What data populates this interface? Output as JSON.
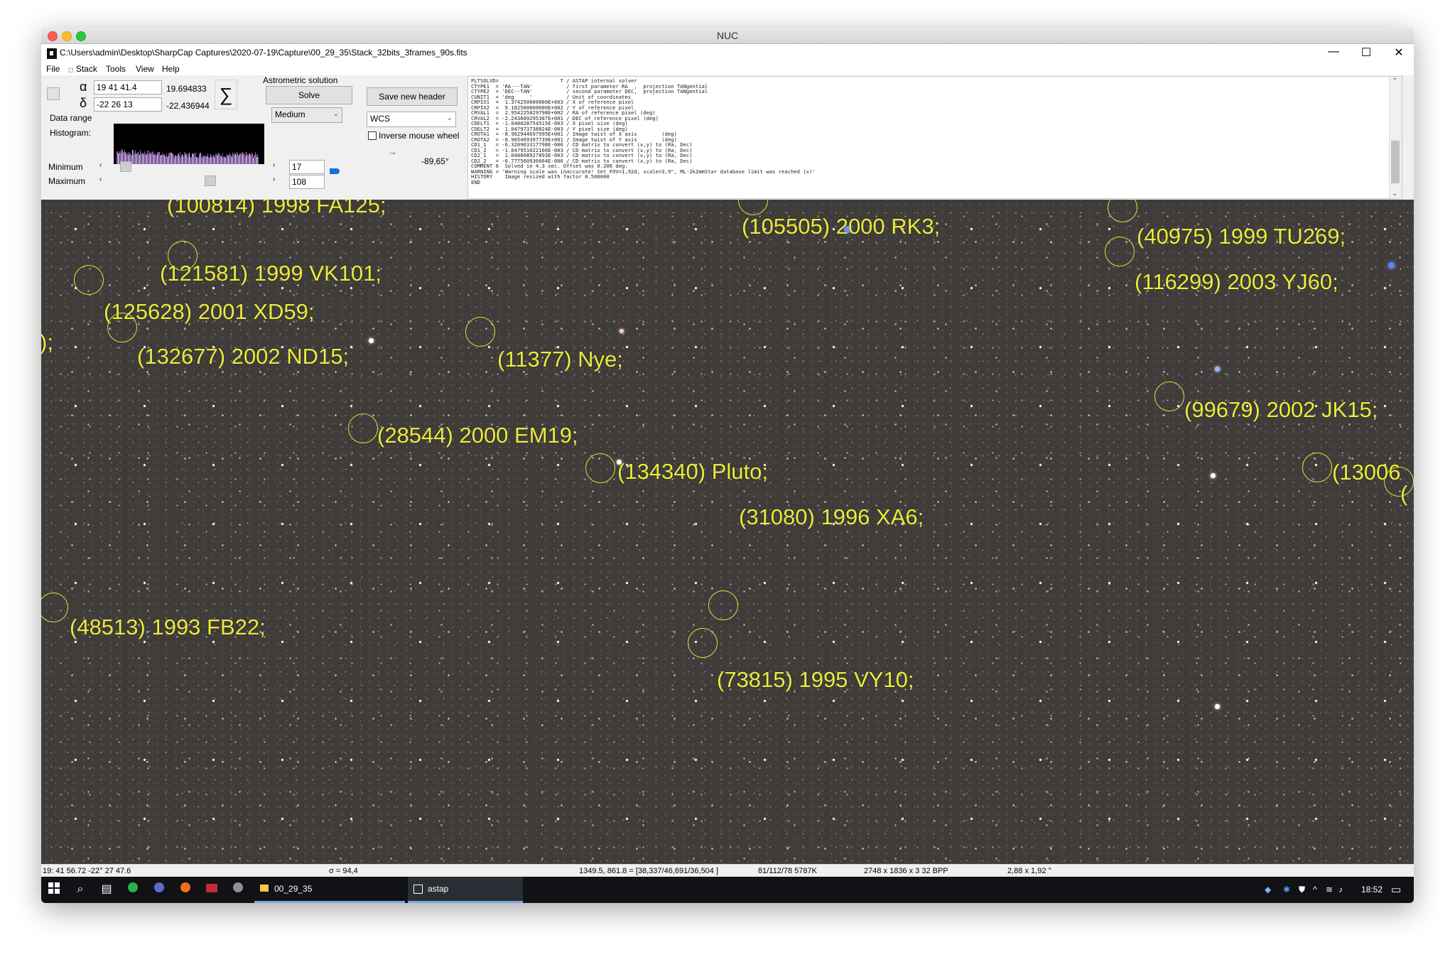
{
  "mac_window": {
    "title": "NUC"
  },
  "app": {
    "path_title": "C:\\Users\\admin\\Desktop\\SharpCap Captures\\2020-07-19\\Capture\\00_29_35\\Stack_32bits_3frames_90s.fits",
    "window_controls": {
      "minimize": "—",
      "maximize": "☐",
      "close": "✕"
    }
  },
  "menu": {
    "file": "File",
    "stack": "Stack",
    "tools": "Tools",
    "view": "View",
    "help": "Help"
  },
  "panel": {
    "alpha_symbol": "α",
    "delta_symbol": "δ",
    "ra_input": "19 41  41.4",
    "ra_decimal": "19.694833",
    "dec_input": "-22 26  13",
    "dec_decimal": "-22.436944",
    "sigma_symbol": "∑",
    "data_range_label": "Data range",
    "histogram_label": "Histogram:",
    "minimum_label": "Minimum",
    "maximum_label": "Maximum",
    "minimum_value": "17",
    "maximum_value": "108",
    "minimum_slider_fraction": 0.07,
    "maximum_slider_fraction": 0.5,
    "range_select": "2",
    "quality_select": "Medium",
    "astrometric_label": "Astrometric solution",
    "solve_button": "Solve",
    "save_header_button": "Save new header",
    "projection_select": "WCS",
    "inverse_wheel_label": "Inverse mouse wheel",
    "inverse_wheel_checked": false,
    "rotation_readout": "-89,65°"
  },
  "fits_header": [
    "PLTSOLVD=                    T / ASTAP internal solver",
    "CTYPE1  = 'RA---TAN'           / first parameter RA  ,  projection TANgential",
    "CTYPE2  = 'DEC--TAN'           / second parameter DEC,  projection TANgential",
    "CUNIT1  = 'deg     '           / Unit of coordinates",
    "CRPIX1  =  1.374250000000E+003 / X of reference pixel",
    "CRPIX2  =  9.182500000000E+002 / Y of reference pixel",
    "CRVAL1  =  2.954225029798E+002 / RA of reference pixel (deg)",
    "CRVAL2  = -2.243689295387E+001 / DEC of reference pixel (deg)",
    "CDELT1  = -1.048828754515E-003 / X pixel size (deg)",
    "CDELT2  =  1.047973738824E-003 / Y pixel size (deg)",
    "CROTA1  = -8.962944697995E+001 / Image twist of X axis        (deg)",
    "CROTA2  = -8.965469397739E+001 / Image twist of Y axis        (deg)",
    "CD1_1   = -6.320963317798E-006 / CD matrix to convert (x,y) to (Ra, Dec)",
    "CD1_2   = -1.047951022166E-003 / CD matrix to convert (x,y) to (Ra, Dec)",
    "CD2_1   =  1.048808927893E-003 / CD matrix to convert (x,y) to (Ra, Dec)",
    "CD2_2   = -6.777560936664E-006 / CD matrix to convert (x,y) to (Ra, Dec)",
    "COMMENT 6  Solved in 4.3 sec. Offset was 0.206 deg.",
    "WARNING = 'Warning scale was inaccurate! Set FOV=1,92d, scale=3,9\", ML-2k2mmStar database limit was reached (x)'",
    "HISTORY    Image resized with factor 0.500000",
    "END"
  ],
  "asteroids": [
    {
      "label": "(100814) 1998 FA125;"
    },
    {
      "label": "(105505) 2000 RK3;"
    },
    {
      "label": "(40975) 1999 TU269;"
    },
    {
      "label": "(121581) 1999 VK101;"
    },
    {
      "label": "(116299) 2003 YJ60;"
    },
    {
      "label": "(125628) 2001 XD59;"
    },
    {
      "label": "(132677) 2002 ND15;"
    },
    {
      "label": "(11377) Nye;"
    },
    {
      "label": "(99679) 2002 JK15;"
    },
    {
      "label": "(28544) 2000 EM19;"
    },
    {
      "label": "(134340) Pluto;"
    },
    {
      "label": "(13006"
    },
    {
      "label": "(31080) 1996 XA6;"
    },
    {
      "label": "(48513) 1993 FB22;"
    },
    {
      "label": "(73815) 1995 VY10;"
    }
  ],
  "status": {
    "cursor_radec": "19: 41  56.72   -22° 27  47.6",
    "sigma": "σ = 94,4",
    "pixel_info": "1349.5, 861.8 = [38,337/46,691/36,504 ]",
    "stats": "81/112/78  5787K",
    "dimensions": "2748 x 1836 x 3   32 BPP",
    "fov": "2,88 x 1,92 °"
  },
  "taskbar": {
    "app1": "00_29_35",
    "app2": "astap",
    "clock": "18:52"
  },
  "colors": {
    "annotation": "#ecec3c",
    "background_sky": "#3f3c3a"
  }
}
